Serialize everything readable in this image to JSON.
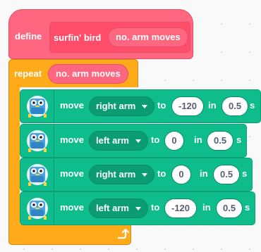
{
  "define_block": {
    "define_label": "define",
    "custom_block_name": "surfin' bird",
    "parameter": "no. arm moves"
  },
  "repeat_block": {
    "label": "repeat",
    "argument": "no. arm moves"
  },
  "move_blocks": [
    {
      "move_label": "move",
      "arm": "right arm",
      "to_label": "to",
      "angle": "-120",
      "in_label": "in",
      "duration": "0.5",
      "unit": "s"
    },
    {
      "move_label": "move",
      "arm": "left arm",
      "to_label": "to",
      "angle": "0",
      "in_label": "in",
      "duration": "0.5",
      "unit": "s"
    },
    {
      "move_label": "move",
      "arm": "right arm",
      "to_label": "to",
      "angle": "0",
      "in_label": "in",
      "duration": "0.5",
      "unit": "s"
    },
    {
      "move_label": "move",
      "arm": "left arm",
      "to_label": "to",
      "angle": "-120",
      "in_label": "in",
      "duration": "0.5",
      "unit": "s"
    }
  ],
  "icons": {
    "extension_icon": "robot-face-icon",
    "loop_icon": "loop-arrow-icon",
    "dropdown_icon": "caret-down-icon"
  },
  "colors": {
    "my_blocks": "#ff6680",
    "control": "#ffab19",
    "extension": "#0fbd8c"
  }
}
